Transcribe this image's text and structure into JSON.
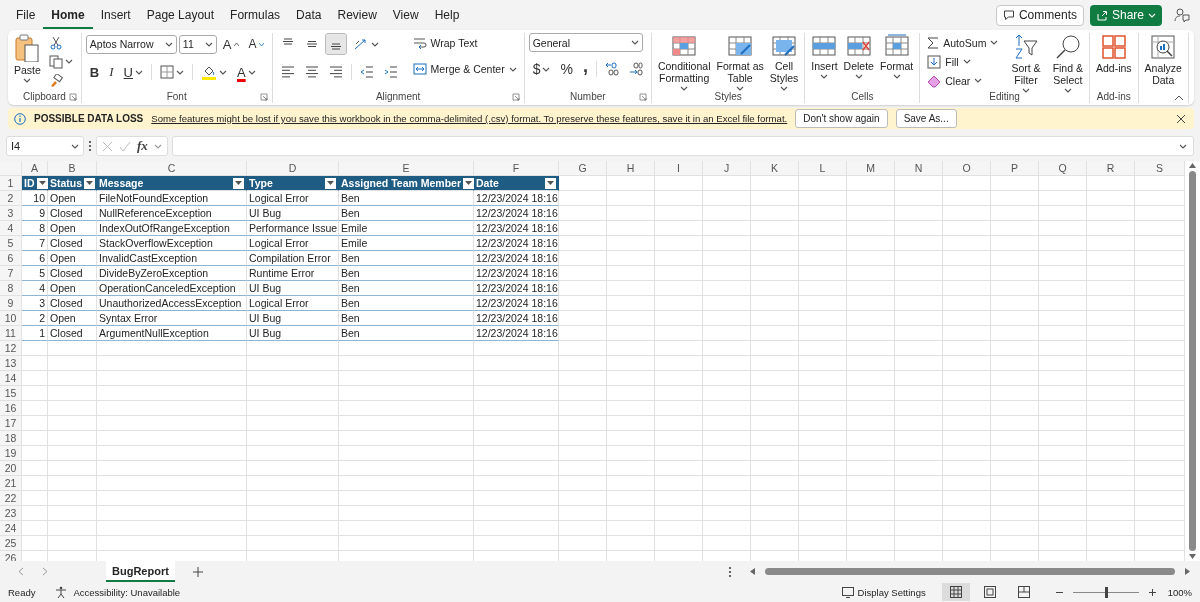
{
  "menu_tabs": [
    {
      "label": "File",
      "selected": false
    },
    {
      "label": "Home",
      "selected": true
    },
    {
      "label": "Insert",
      "selected": false
    },
    {
      "label": "Page Layout",
      "selected": false
    },
    {
      "label": "Formulas",
      "selected": false
    },
    {
      "label": "Data",
      "selected": false
    },
    {
      "label": "Review",
      "selected": false
    },
    {
      "label": "View",
      "selected": false
    },
    {
      "label": "Help",
      "selected": false
    }
  ],
  "header_buttons": {
    "comments": "Comments",
    "share": "Share"
  },
  "ribbon": {
    "groups": [
      {
        "kind": "clipboard",
        "label": "Clipboard",
        "controls": [
          "Paste"
        ]
      },
      {
        "kind": "font",
        "label": "Font",
        "font_name": "Aptos Narrow",
        "font_size": "11",
        "glyphs": [
          "A",
          "A",
          "B",
          "I",
          "U",
          "A"
        ]
      },
      {
        "kind": "alignment",
        "label": "Alignment",
        "controls": [
          "Wrap Text",
          "Merge & Center"
        ],
        "vertical_align": [
          {
            "selected": false
          },
          {
            "selected": false
          },
          {
            "selected": true
          }
        ]
      },
      {
        "kind": "number",
        "label": "Number",
        "format": "General",
        "symbols": [
          "$",
          "%",
          ","
        ]
      },
      {
        "kind": "styles",
        "label": "Styles",
        "controls": [
          "Conditional\nFormatting",
          "Format as\nTable",
          "Cell\nStyles"
        ]
      },
      {
        "kind": "cells",
        "label": "Cells",
        "controls": [
          "Insert",
          "Delete",
          "Format"
        ]
      },
      {
        "kind": "editing",
        "label": "Editing",
        "controls": [
          "AutoSum",
          "Fill",
          "Clear",
          "Sort &\nFilter",
          "Find &\nSelect"
        ]
      },
      {
        "kind": "addins",
        "label": "Add-ins",
        "controls": [
          "Add-ins"
        ]
      },
      {
        "kind": "analyze",
        "controls": [
          "Analyze\nData"
        ]
      }
    ]
  },
  "message_bar": {
    "title": "POSSIBLE DATA LOSS",
    "message": "Some features might be lost if you save this workbook in the comma-delimited (.csv) format. To preserve these features, save it in an Excel file format.",
    "buttons": [
      "Don't show again",
      "Save As..."
    ]
  },
  "formula_bar": {
    "name_box": "I4",
    "function_label": "fx"
  },
  "sheet": {
    "columns": [
      "A",
      "B",
      "C",
      "D",
      "E",
      "F",
      "G",
      "H",
      "I",
      "J",
      "K",
      "L",
      "M",
      "N",
      "O",
      "P",
      "Q",
      "R",
      "S"
    ],
    "row_numbers": [
      "1",
      "2",
      "3",
      "4",
      "5",
      "6",
      "7",
      "8",
      "9",
      "10",
      "11",
      "12",
      "13",
      "14",
      "15",
      "16",
      "17",
      "18",
      "19",
      "20",
      "21",
      "22",
      "23",
      "24",
      "25",
      "26"
    ],
    "table": {
      "headers": [
        "ID",
        "Status",
        "Message",
        "Type",
        "Assigned Team Member",
        "Date"
      ],
      "rows": [
        [
          "10",
          "Open",
          "FileNotFoundException",
          "Logical Error",
          "Ben",
          "12/23/2024 18:16"
        ],
        [
          "9",
          "Closed",
          "NullReferenceException",
          "UI Bug",
          "Ben",
          "12/23/2024 18:16"
        ],
        [
          "8",
          "Open",
          "IndexOutOfRangeException",
          "Performance Issue",
          "Emile",
          "12/23/2024 18:16"
        ],
        [
          "7",
          "Closed",
          "StackOverflowException",
          "Logical Error",
          "Emile",
          "12/23/2024 18:16"
        ],
        [
          "6",
          "Open",
          "InvalidCastException",
          "Compilation Error",
          "Ben",
          "12/23/2024 18:16"
        ],
        [
          "5",
          "Closed",
          "DivideByZeroException",
          "Runtime Error",
          "Ben",
          "12/23/2024 18:16"
        ],
        [
          "4",
          "Open",
          "OperationCanceledException",
          "UI Bug",
          "Ben",
          "12/23/2024 18:16"
        ],
        [
          "3",
          "Closed",
          "UnauthorizedAccessException",
          "Logical Error",
          "Ben",
          "12/23/2024 18:16"
        ],
        [
          "2",
          "Open",
          "Syntax Error",
          "UI Bug",
          "Ben",
          "12/23/2024 18:16"
        ],
        [
          "1",
          "Closed",
          "ArgumentNullException",
          "UI Bug",
          "Ben",
          "12/23/2024 18:16"
        ]
      ]
    }
  },
  "sheet_tabs": [
    {
      "label": "BugReport",
      "selected": true
    }
  ],
  "status_bar": {
    "status": "Ready",
    "accessibility": "Accessibility: Unavailable",
    "display_settings": "Display Settings",
    "views": [
      {
        "selected": true
      },
      {
        "selected": false
      },
      {
        "selected": false
      }
    ],
    "zoom": {
      "level": 0.5,
      "reading": "100%"
    }
  }
}
